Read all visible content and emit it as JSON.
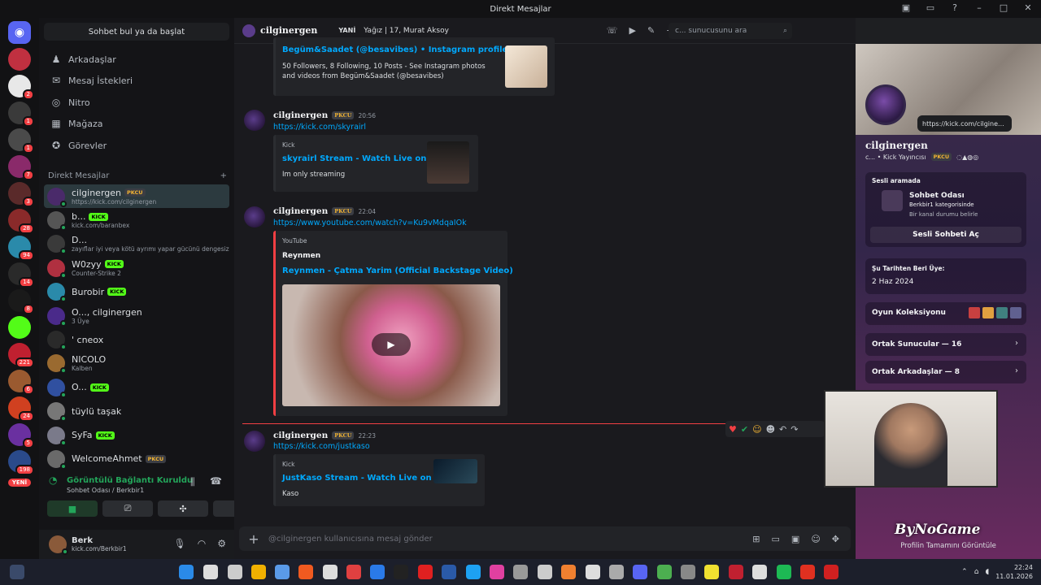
{
  "window_title": "Direkt Mesajlar",
  "dm_search": "Sohbet bul ya da başlat",
  "nav": [
    "Arkadaşlar",
    "Mesaj İstekleri",
    "Nitro",
    "Mağaza",
    "Görevler"
  ],
  "dm_header": "Direkt Mesajlar",
  "dms": [
    {
      "name": "cilginergen",
      "tag": "PKCU",
      "sub": "https://kick.com/cilginergen",
      "color": "#4a2a6a",
      "active": true
    },
    {
      "name": "b...",
      "tag": "KICK",
      "sub": "kick.com/baranbex",
      "color": "#555"
    },
    {
      "name": "D...",
      "tag": "",
      "sub": "zayıflar iyi veya kötü ayrımı yapar gücünü dengesiz ...",
      "color": "#3a3a3a"
    },
    {
      "name": "W0zyy",
      "tag": "KICK",
      "sub": "Counter-Strike 2",
      "color": "#b03040"
    },
    {
      "name": "Burobir",
      "tag": "KICK",
      "sub": "",
      "color": "#2a8aaa"
    },
    {
      "name": "O..., cilginergen",
      "tag": "",
      "sub": "3 Üye",
      "color": "#4a2a8a"
    },
    {
      "name": "' cneox",
      "tag": "",
      "sub": "",
      "color": "#2a2a2a"
    },
    {
      "name": "NICOLO",
      "tag": "",
      "sub": "Kalben",
      "color": "#9a6a30"
    },
    {
      "name": "O...",
      "tag": "KICK",
      "sub": "",
      "color": "#3050a0"
    },
    {
      "name": "tüylü taşak",
      "tag": "",
      "sub": "",
      "color": "#777"
    },
    {
      "name": "SyFa",
      "tag": "KICK",
      "sub": "",
      "color": "#7a7a8a"
    },
    {
      "name": "WelcomeAhmet",
      "tag": "PKCU",
      "sub": "",
      "color": "#6a6a6a"
    }
  ],
  "voice": {
    "title": "Görüntülü Bağlantı Kuruldu",
    "sub": "Sohbet Odası / Berkbir1"
  },
  "user": {
    "name": "Berk",
    "sub": "kick.com/Berkbir1"
  },
  "server_badges": [
    "",
    "2",
    "1",
    "1",
    "7",
    "3",
    "28",
    "94",
    "14",
    "8",
    "",
    "221",
    "6",
    "24",
    "5",
    "198",
    "YENİ"
  ],
  "chat": {
    "name": "cilginergen",
    "new": "YANİ",
    "status": "Yağız | 17, Murat Aksoy",
    "search": "c... sunucusunu ara",
    "composer": "@cilginergen kullanıcısına mesaj gönder"
  },
  "messages": [
    {
      "embed_title": "Begüm&Saadet (@besavibes) • Instagram profile",
      "embed_desc": "50 Followers, 8 Following, 10 Posts - See Instagram photos and videos from Begüm&Saadet (@besavibes)"
    },
    {
      "name": "cilginergen",
      "tag": "PKCU",
      "time": "20:56",
      "link": "https://kick.com/skyrairl",
      "provider": "Kick",
      "embed_title": "skyrairl Stream - Watch Live on Kick",
      "embed_desc": "Im only streaming"
    },
    {
      "name": "cilginergen",
      "tag": "PKCU",
      "time": "22:04",
      "link": "https://www.youtube.com/watch?v=Ku9vMdqaIOk",
      "provider": "YouTube",
      "author": "Reynmen",
      "embed_title": "Reynmen - Çatma Yarim (Official Backstage Video)"
    },
    {
      "name": "cilginergen",
      "tag": "PKCU",
      "time": "22:23",
      "link": "https://kick.com/justkaso",
      "provider": "Kick",
      "embed_title": "JustKaso Stream - Watch Live on Kick",
      "embed_desc": "Kaso"
    }
  ],
  "profile": {
    "link": "https://kick.com/cilgine...",
    "name": "cilginergen",
    "sub": "c...  •  Kick Yayıncısı",
    "tag": "PKCU",
    "voice_h": "Sesli aramada",
    "voice_room": "Sohbet Odası",
    "voice_cat": "Berkbir1 kategorisinde",
    "voice_status": "Bir kanal durumu belirle",
    "voice_btn": "Sesli Sohbeti Aç",
    "member_h": "Şu Tarihten Beri Üye:",
    "member_date": "2 Haz 2024",
    "games": "Oyun Koleksiyonu",
    "servers": "Ortak Sunucular — 16",
    "friends": "Ortak Arkadaşlar — 8",
    "brand": "ByNoGame",
    "footer": "Profilin Tamamını Görüntüle"
  },
  "clock": {
    "time": "22:24",
    "date": "11.01.2026"
  },
  "colors": {
    "accent": "#5865f2",
    "link": "#00a8fc",
    "online": "#23a55a",
    "kick": "#53fc18",
    "danger": "#f23f43"
  }
}
